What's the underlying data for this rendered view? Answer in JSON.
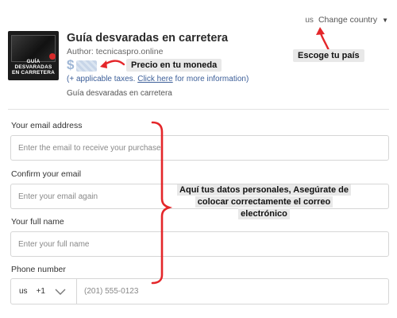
{
  "country": {
    "code": "us",
    "label": "Change country"
  },
  "product": {
    "cover_text": "GUÍA DESVARADAS EN CARRETERA",
    "title": "Guía desvaradas en carretera",
    "author": "Author: tecnicaspro.online",
    "price_symbol": "$",
    "taxes_prefix": "(+ applicable taxes. ",
    "taxes_link": "Click here",
    "taxes_suffix": " for more information)",
    "description": "Guía desvaradas en carretera"
  },
  "form": {
    "email_label": "Your email address",
    "email_placeholder": "Enter the email to receive your purchase",
    "confirm_label": "Confirm your email",
    "confirm_placeholder": "Enter your email again",
    "name_label": "Your full name",
    "name_placeholder": "Enter your full name",
    "phone_label": "Phone number",
    "phone_country": "us",
    "phone_dial": "+1",
    "phone_placeholder": "(201) 555-0123"
  },
  "annotations": {
    "price": "Precio en tu moneda",
    "country": "Escoge tu país",
    "form_line1": "Aquí tus datos personales, Asegúrate de",
    "form_line2": "colocar correctamente el correo",
    "form_line3": "electrónico"
  },
  "colors": {
    "annotation_red": "#e4262a",
    "link_blue": "#3d5f99",
    "price_blue": "#9fb7d6"
  }
}
